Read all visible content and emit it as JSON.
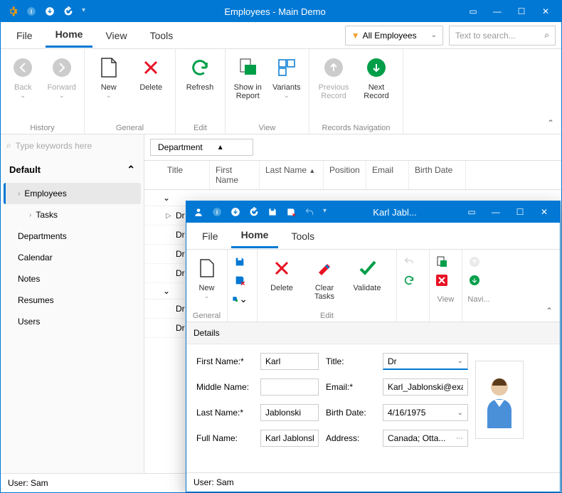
{
  "main": {
    "title": "Employees - Main Demo",
    "menu": {
      "file": "File",
      "home": "Home",
      "view": "View",
      "tools": "Tools"
    },
    "filter": "All Employees",
    "search_placeholder": "Text to search...",
    "ribbon": {
      "history": {
        "back": "Back",
        "forward": "Forward",
        "label": "History"
      },
      "general": {
        "new": "New",
        "delete": "Delete",
        "label": "General"
      },
      "edit": {
        "refresh": "Refresh",
        "label": "Edit"
      },
      "view": {
        "show_report": "Show in Report",
        "variants": "Variants",
        "label": "View"
      },
      "nav": {
        "prev": "Previous Record",
        "next": "Next Record",
        "label": "Records Navigation"
      }
    },
    "sidebar": {
      "search_placeholder": "Type keywords here",
      "header": "Default",
      "items": [
        "Employees",
        "Tasks",
        "Departments",
        "Calendar",
        "Notes",
        "Resumes",
        "Users"
      ]
    },
    "group_by": "Department",
    "columns": {
      "title": "Title",
      "first": "First Name",
      "last": "Last Name",
      "position": "Position",
      "email": "Email",
      "birth": "Birth Date"
    },
    "rows": [
      "Dr",
      "Dr",
      "Dr",
      "Dr",
      "Dr",
      "Dr"
    ],
    "status": "User: Sam"
  },
  "detail": {
    "title": "Karl Jabl...",
    "menu": {
      "file": "File",
      "home": "Home",
      "tools": "Tools"
    },
    "ribbon": {
      "new": "New",
      "delete": "Delete",
      "clear": "Clear Tasks",
      "validate": "Validate",
      "general": "General",
      "edit": "Edit",
      "view": "View",
      "nav": "Navi..."
    },
    "details_label": "Details",
    "form": {
      "first_label": "First Name:*",
      "first_value": "Karl",
      "middle_label": "Middle Name:",
      "middle_value": "",
      "last_label": "Last Name:*",
      "last_value": "Jablonski",
      "full_label": "Full Name:",
      "full_value": "Karl Jablonski",
      "title_label": "Title:",
      "title_value": "Dr",
      "email_label": "Email:*",
      "email_value": "Karl_Jablonski@example.com",
      "birth_label": "Birth Date:",
      "birth_value": "4/16/1975",
      "addr_label": "Address:",
      "addr_value": "Canada; Otta..."
    },
    "status": "User: Sam"
  }
}
